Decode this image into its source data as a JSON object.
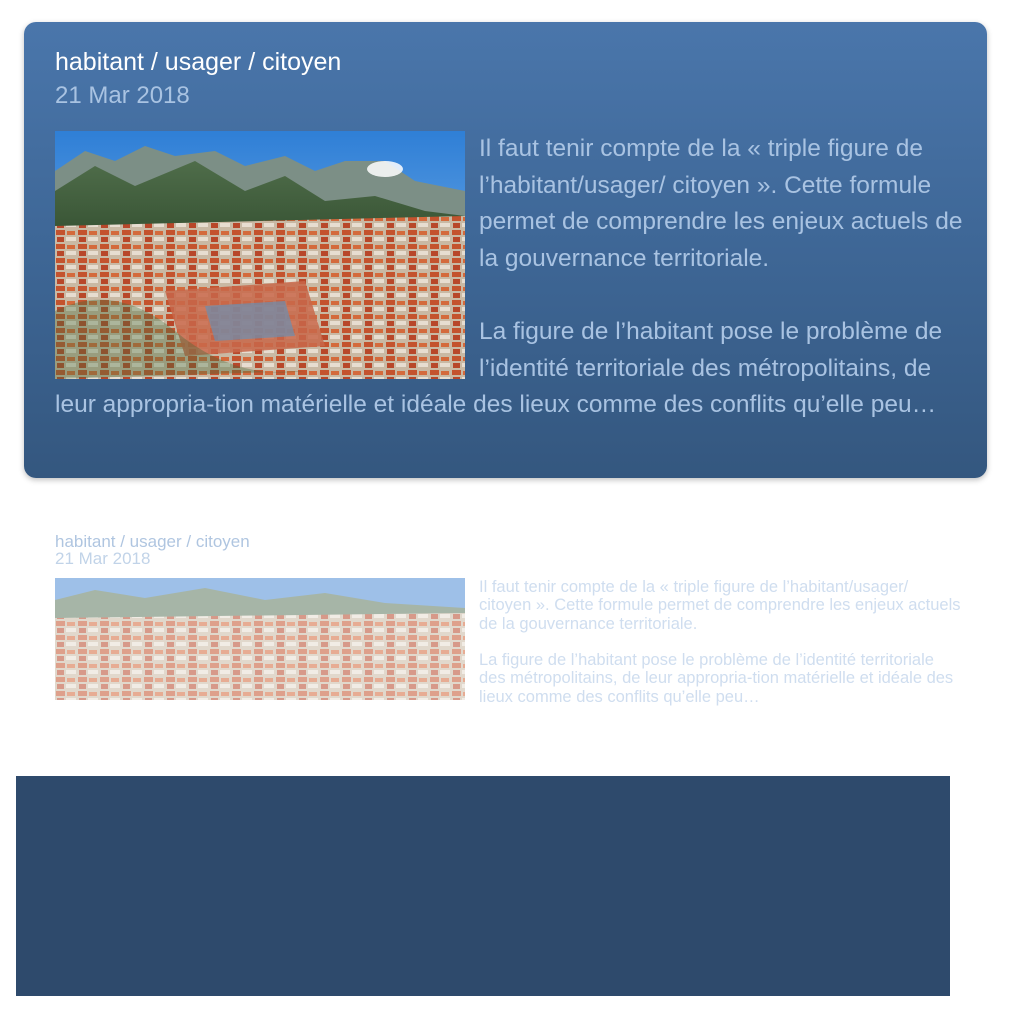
{
  "card": {
    "title": "habitant / usager / citoyen",
    "date": "21 Mar 2018",
    "image_alt": "Aerial view of a city with mountains",
    "paragraph_1": "Il faut tenir compte de la « triple figure de l’habitant/usager/ citoyen ». Cette formule permet de comprendre les enjeux actuels de la gouvernance territoriale.",
    "paragraph_2": "La figure de l’habitant pose le problème de l’identité territoriale des métropolitains, de leur appropria-tion matérielle et idéale des lieux comme des conflits qu’elle peu…"
  },
  "reflection": {
    "title": "habitant / usager / citoyen",
    "date": "21 Mar 2018",
    "paragraph_1": "Il faut tenir compte de la « triple figure de l’habitant/usager/ citoyen ». Cette formule permet de comprendre les enjeux actuels de la gouvernance territoriale.",
    "paragraph_2": "La figure de l’habitant pose le problème de l’identité territoriale des métropolitains, de leur appropria-tion matérielle et idéale des lieux comme des conflits qu’elle peu…"
  },
  "colors": {
    "card_top": "#4a76ab",
    "card_bottom": "#34577f",
    "title_text": "#ffffff",
    "secondary_text": "#a9c3e2",
    "bottom_panel": "#2e4a6c"
  }
}
